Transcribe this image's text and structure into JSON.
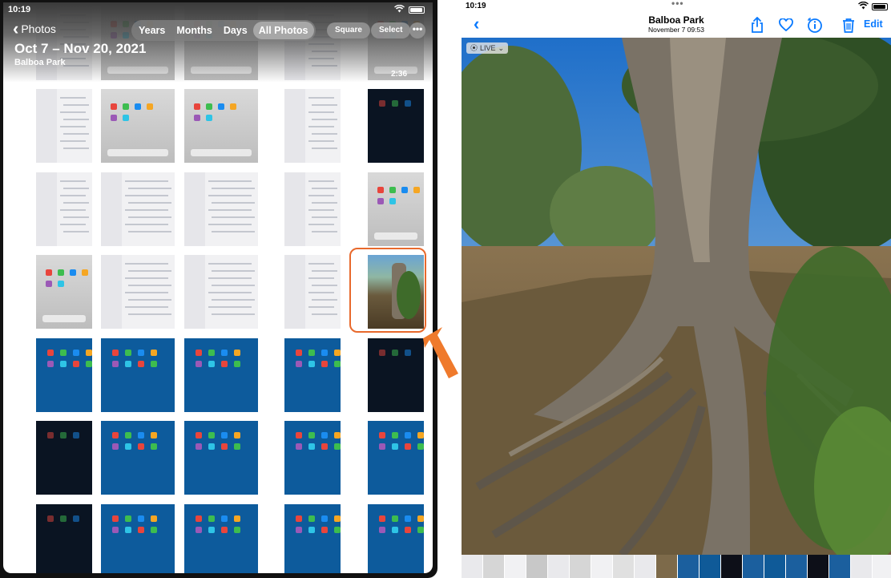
{
  "left": {
    "status_time": "10:19",
    "back_label": "Photos",
    "date_range": "Oct 7 – Nov 20, 2021",
    "location": "Balboa Park",
    "segments": [
      "Years",
      "Months",
      "Days",
      "All Photos"
    ],
    "active_segment": "All Photos",
    "square_label": "Square",
    "select_label": "Select",
    "more_label": "•••",
    "video_duration": "2:36"
  },
  "right": {
    "status_time": "10:19",
    "multitask_dots": "•••",
    "title": "Balboa Park",
    "subtitle": "November 7  09:53",
    "edit_label": "Edit",
    "live_label": "LIVE"
  },
  "colors": {
    "accent": "#0a7aff",
    "highlight": "#e8692c"
  },
  "icons": [
    "chevron-left-icon",
    "wifi-icon",
    "battery-icon",
    "share-icon",
    "heart-icon",
    "info-icon",
    "trash-icon",
    "live-photo-icon",
    "arrow-icon"
  ]
}
